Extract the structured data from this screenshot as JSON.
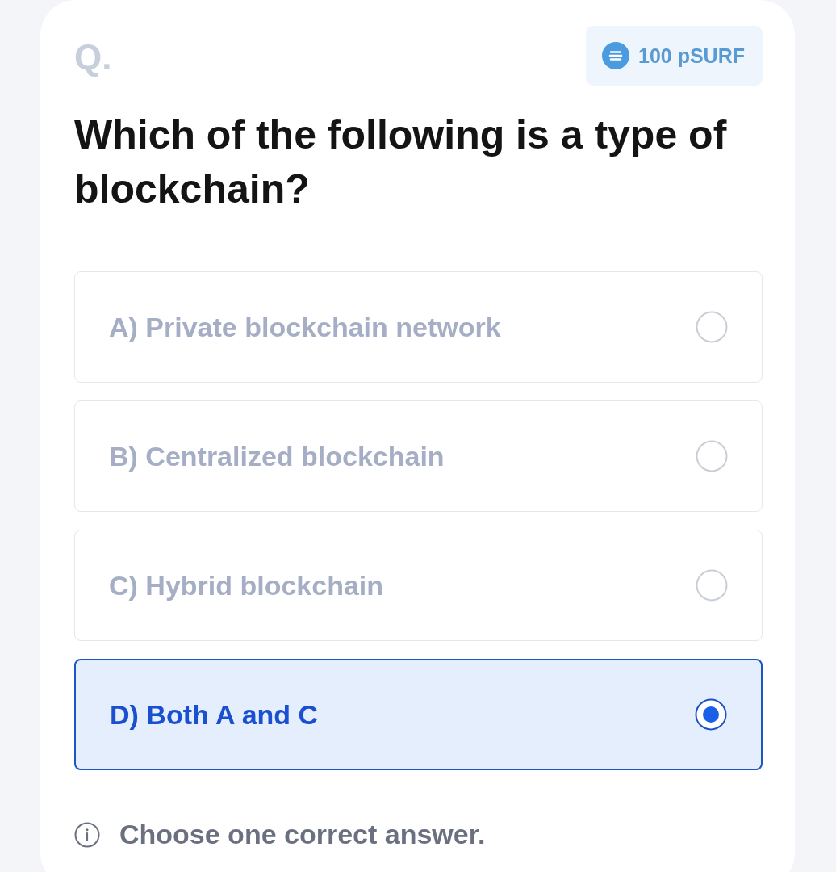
{
  "header": {
    "label": "Q.",
    "reward": "100 pSURF"
  },
  "question": "Which of the following is a type of blockchain?",
  "options": [
    {
      "label": "A) Private blockchain network",
      "selected": false
    },
    {
      "label": "B) Centralized blockchain",
      "selected": false
    },
    {
      "label": "C) Hybrid blockchain",
      "selected": false
    },
    {
      "label": "D) Both A and C",
      "selected": true
    }
  ],
  "hint": "Choose one correct answer."
}
